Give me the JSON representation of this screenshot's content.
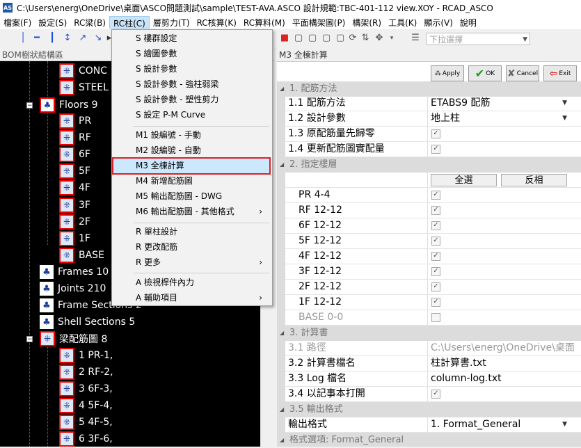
{
  "window": {
    "title": "C:\\Users\\energ\\OneDrive\\桌面\\ASCO問題測試\\sample\\TEST-AVA.ASCO 設計規範:TBC-401-112 view.XOY - RCAD_ASCO",
    "app_icon": "AS"
  },
  "menubar": [
    "檔案(F)",
    "設定(S)",
    "RC梁(B)",
    "RC柱(C)",
    "層剪力(T)",
    "RC核算(K)",
    "RC算料(M)",
    "平面構架圖(P)",
    "構架(R)",
    "工具(K)",
    "顯示(V)",
    "說明"
  ],
  "toolbar": {
    "dropdown_placeholder": "下拉選擇"
  },
  "left_panel": {
    "header": "BOM樹狀結構區",
    "tree": [
      {
        "label": "CONC",
        "icon": "grid-icon"
      },
      {
        "label": "STEEL",
        "icon": "grid-icon"
      },
      {
        "label": "Floors 9",
        "icon": "folder-icon"
      },
      {
        "label": "PR",
        "icon": "grid-icon"
      },
      {
        "label": "RF",
        "icon": "grid-icon"
      },
      {
        "label": "6F",
        "icon": "grid-icon"
      },
      {
        "label": "5F",
        "icon": "grid-icon"
      },
      {
        "label": "4F",
        "icon": "grid-icon"
      },
      {
        "label": "3F",
        "icon": "grid-icon"
      },
      {
        "label": "2F",
        "icon": "grid-icon"
      },
      {
        "label": "1F",
        "icon": "grid-icon"
      },
      {
        "label": "BASE",
        "icon": "grid-icon"
      },
      {
        "label": "Frames 10",
        "icon": "folder-icon"
      },
      {
        "label": "Joints 210",
        "icon": "folder-icon"
      },
      {
        "label": "Frame Sections 2",
        "icon": "folder-icon"
      },
      {
        "label": "Shell Sections 5",
        "icon": "folder-icon"
      },
      {
        "label": "梁配筋圖 8",
        "icon": "folder-icon"
      },
      {
        "label": "1 PR-1,",
        "icon": "grid-icon"
      },
      {
        "label": "2 RF-2,",
        "icon": "grid-icon"
      },
      {
        "label": "3 6F-3,",
        "icon": "grid-icon"
      },
      {
        "label": "4 5F-4,",
        "icon": "grid-icon"
      },
      {
        "label": "5 4F-5,",
        "icon": "grid-icon"
      },
      {
        "label": "6 3F-6,",
        "icon": "grid-icon"
      }
    ]
  },
  "rc_column_menu": {
    "items": [
      {
        "label": "S 樓群設定"
      },
      {
        "label": "S 繪圖參數"
      },
      {
        "label": "S 設計參數"
      },
      {
        "label": "S 設計參數 - 強柱弱梁"
      },
      {
        "label": "S 設計參數 - 塑性剪力"
      },
      {
        "label": "S 設定 P-M Curve"
      },
      {
        "label": "M1 設編號 - 手動"
      },
      {
        "label": "M2 設編號 - 自動"
      },
      {
        "label": "M3 全棟計算"
      },
      {
        "label": "M4 新增配筋圖"
      },
      {
        "label": "M5 輸出配筋圖 - DWG"
      },
      {
        "label": "M6 輸出配筋圖 - 其他格式",
        "submenu": "›"
      },
      {
        "label": "R 單柱設計"
      },
      {
        "label": "R 更改配筋"
      },
      {
        "label": "R 更多",
        "submenu": "›"
      },
      {
        "label": "A 檢視桿件內力"
      },
      {
        "label": "A 輔助項目",
        "submenu": "›"
      }
    ]
  },
  "right_panel": {
    "header": "M3 全棟計算",
    "buttons": {
      "apply": "Apply",
      "ok": "OK",
      "cancel": "Cancel",
      "exit": "Exit"
    },
    "sections": {
      "s1": "1. 配筋方法",
      "s2": "2. 指定樓層",
      "s3": "3. 計算書",
      "s35": "3.5 輸出格式",
      "s4": "格式選項: Format_General"
    },
    "props": {
      "p11": {
        "name": "1.1 配筋方法",
        "value": "ETABS9 配筋"
      },
      "p12": {
        "name": "1.2 設計參數",
        "value": "地上柱"
      },
      "p13": {
        "name": "1.3 原配筋量先歸零",
        "value": "✓"
      },
      "p14": {
        "name": "1.4 更新配筋圖實配量",
        "value": "✓"
      },
      "select_all": "全選",
      "invert": "反相",
      "floors": [
        {
          "name": "PR 4-4",
          "value": "✓"
        },
        {
          "name": "RF 12-12",
          "value": "✓"
        },
        {
          "name": "6F 12-12",
          "value": "✓"
        },
        {
          "name": "5F 12-12",
          "value": "✓"
        },
        {
          "name": "4F 12-12",
          "value": "✓"
        },
        {
          "name": "3F 12-12",
          "value": "✓"
        },
        {
          "name": "2F 12-12",
          "value": "✓"
        },
        {
          "name": "1F 12-12",
          "value": "✓"
        },
        {
          "name": "BASE 0-0",
          "value": ""
        }
      ],
      "p31": {
        "name": "3.1 路徑",
        "value": "C:\\Users\\energ\\OneDrive\\桌面"
      },
      "p32": {
        "name": "3.2 計算書檔名",
        "value": "柱計算書.txt"
      },
      "p33": {
        "name": "3.3 Log 檔名",
        "value": "column-log.txt"
      },
      "p34": {
        "name": "3.4 以記事本打開",
        "value": "✓"
      },
      "p_out": {
        "name": "輸出格式",
        "value": "1. Format_General"
      }
    }
  },
  "colors": {
    "tree_bg": "#000000",
    "highlight_border": "#e02020",
    "menu_active": "#cce4f7",
    "popup_selected": "#cce8ff"
  }
}
